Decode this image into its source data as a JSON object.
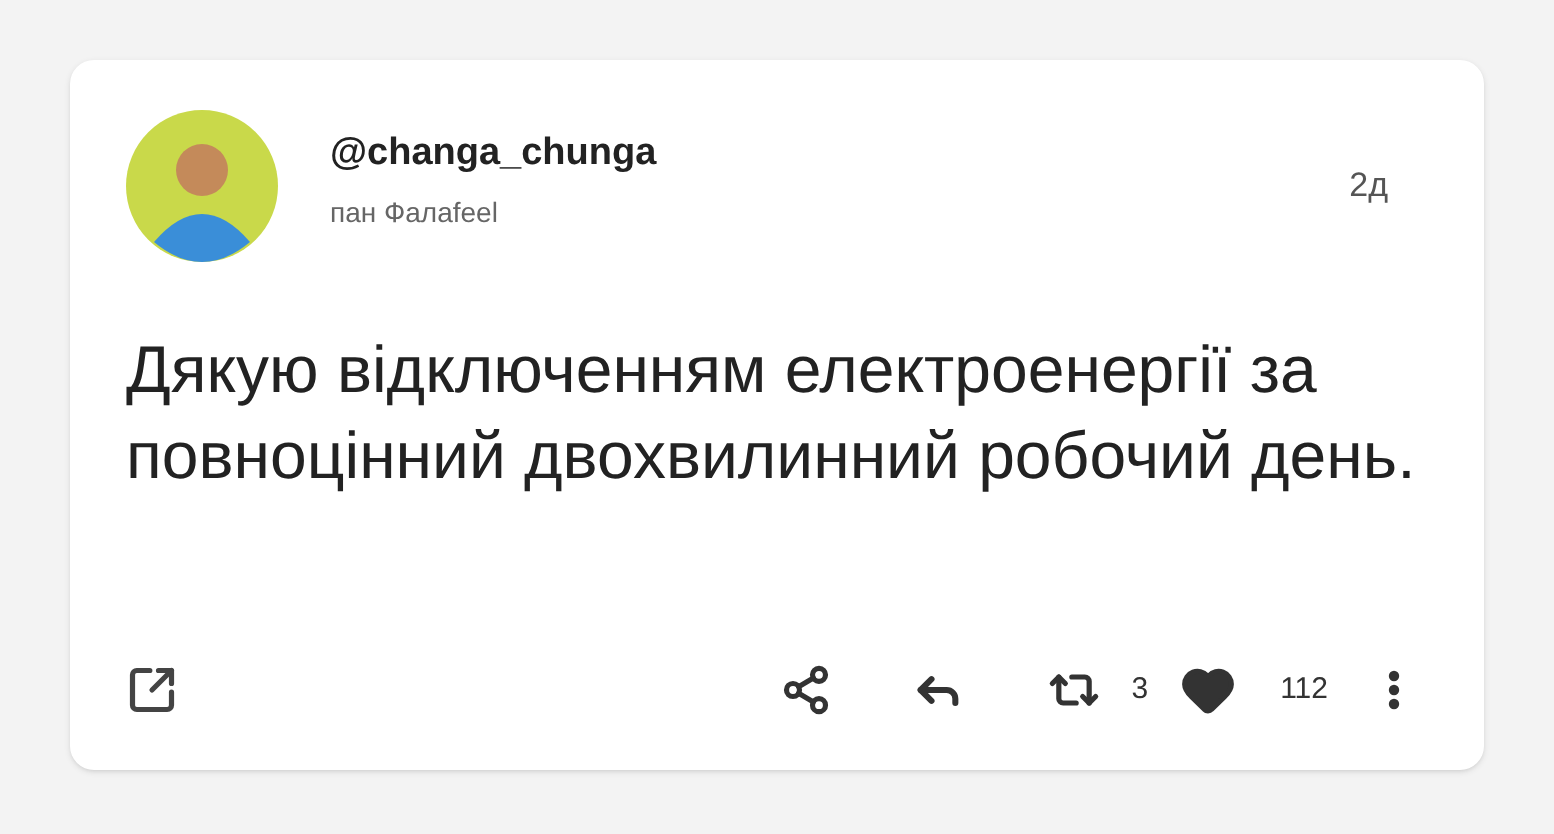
{
  "post": {
    "username": "@changa_chunga",
    "display_name": "пан Фалаfeel",
    "time": "2д",
    "text": "Дякую відключенням електроенергії за повноцінний двохвилинний робочий день.",
    "reposts": "3",
    "likes": "112",
    "liked": true
  }
}
